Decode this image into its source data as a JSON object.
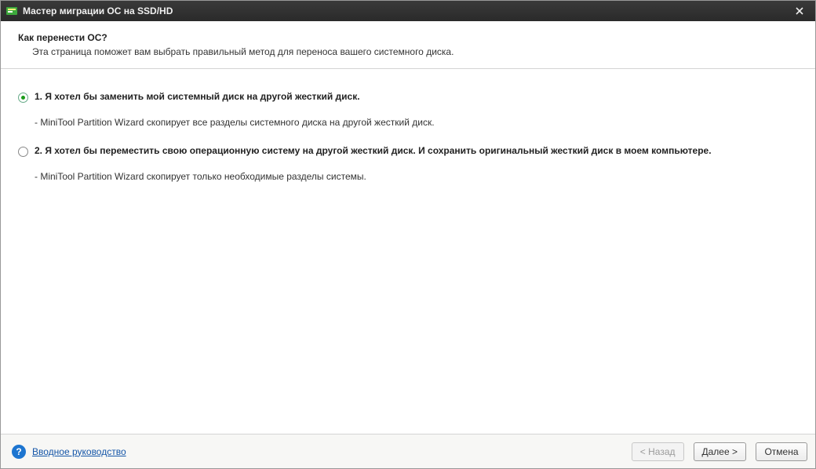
{
  "titlebar": {
    "title": "Мастер миграции ОС на SSD/HD"
  },
  "header": {
    "title": "Как перенести ОС?",
    "subtitle": "Эта страница поможет вам выбрать правильный метод для переноса вашего системного диска."
  },
  "options": [
    {
      "label": "1. Я хотел бы заменить мой системный диск на другой жесткий диск.",
      "description": "- MiniTool Partition Wizard скопирует все разделы системного диска на другой жесткий диск.",
      "selected": true
    },
    {
      "label": "2. Я хотел бы переместить свою операционную систему на другой жесткий диск. И сохранить оригинальный жесткий диск в моем компьютере.",
      "description": "- MiniTool Partition Wizard скопирует только необходимые разделы системы.",
      "selected": false
    }
  ],
  "footer": {
    "help_link": "Вводное руководство",
    "back_label": "< Назад",
    "next_label": "Далее >",
    "cancel_label": "Отмена",
    "back_enabled": false
  }
}
